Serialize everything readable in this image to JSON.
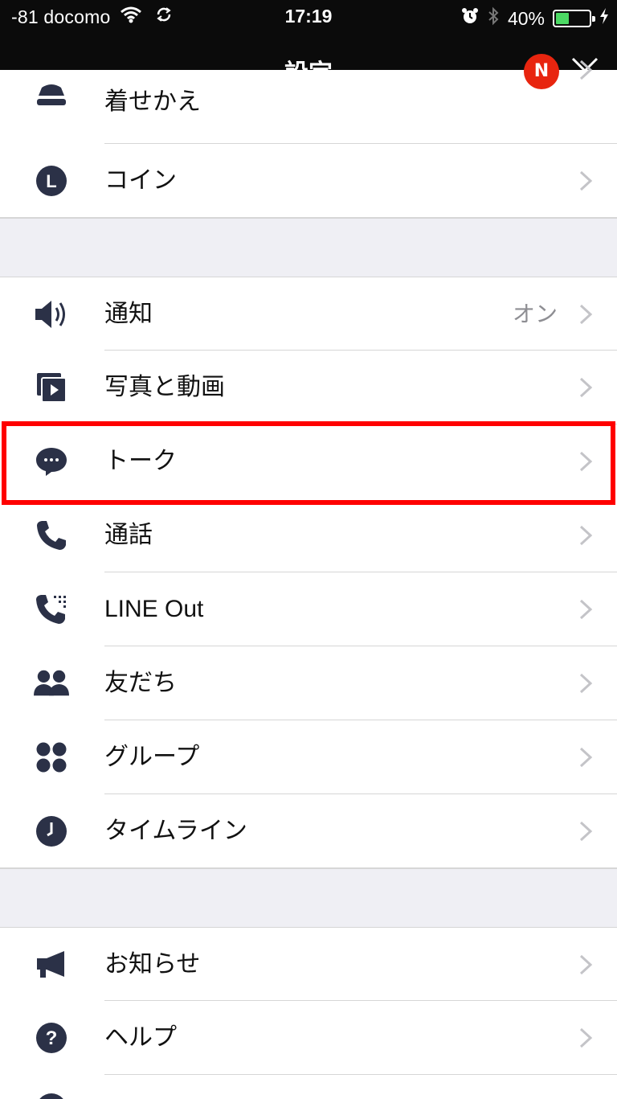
{
  "status_bar": {
    "carrier": "-81 docomo",
    "time": "17:19",
    "battery_percent": "40%",
    "battery_level": 0.4,
    "icons": [
      "wifi-icon",
      "sync-icon",
      "alarm-icon",
      "bluetooth-icon",
      "battery-icon",
      "charging-icon"
    ]
  },
  "header": {
    "title": "設定",
    "close_icon": "close-icon"
  },
  "sections": {
    "top": [
      {
        "label": "着せかえ",
        "icon": "theme-icon",
        "badge": "N"
      },
      {
        "label": "コイン",
        "icon": "coin-icon",
        "icon_text": "L"
      }
    ],
    "middle": [
      {
        "label": "通知",
        "icon": "speaker-icon",
        "value": "オン"
      },
      {
        "label": "写真と動画",
        "icon": "photo-video-icon"
      },
      {
        "label": "トーク",
        "icon": "chat-icon"
      },
      {
        "label": "通話",
        "icon": "phone-icon"
      },
      {
        "label": "LINE Out",
        "icon": "line-out-icon"
      },
      {
        "label": "友だち",
        "icon": "friends-icon"
      },
      {
        "label": "グループ",
        "icon": "group-icon"
      },
      {
        "label": "タイムライン",
        "icon": "timeline-icon"
      }
    ],
    "bottom": [
      {
        "label": "お知らせ",
        "icon": "megaphone-icon"
      },
      {
        "label": "ヘルプ",
        "icon": "help-icon",
        "icon_text": "?"
      }
    ]
  },
  "highlighted_item": "トーク",
  "colors": {
    "header_bg": "#0b0b0b",
    "icon_color": "#2b3147",
    "badge": "#e8250f",
    "highlight_border": "#ff0000",
    "section_gap": "#efeff4"
  }
}
